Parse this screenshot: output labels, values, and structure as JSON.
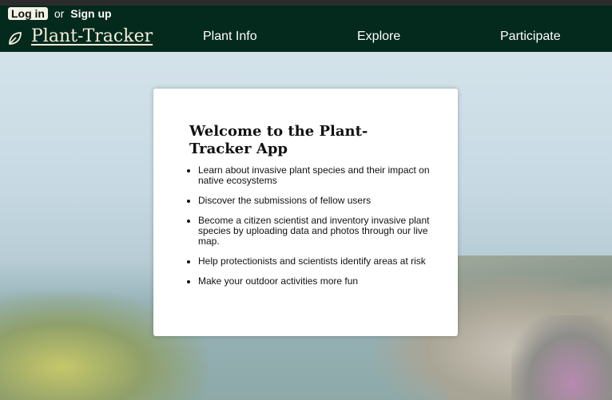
{
  "header": {
    "login_label": "Log in",
    "or_text": "or",
    "signup_label": "Sign up",
    "brand": "Plant-Tracker",
    "brand_icon": "leaf-icon",
    "nav": [
      "Plant Info",
      "Explore",
      "Participate"
    ]
  },
  "card": {
    "title": "Welcome to the Plant-Tracker App",
    "items": [
      "Learn about invasive plant species and their impact on native ecosystems",
      "Discover the submissions of fellow users",
      "Become a citizen scientist and inventory invasive plant species by uploading data and photos through our live map.",
      "Help protectionists and scientists identify areas at risk",
      "Make your outdoor activities more fun"
    ]
  },
  "colors": {
    "header_bg": "#032a1d",
    "brand_text": "#f4f0dc"
  }
}
